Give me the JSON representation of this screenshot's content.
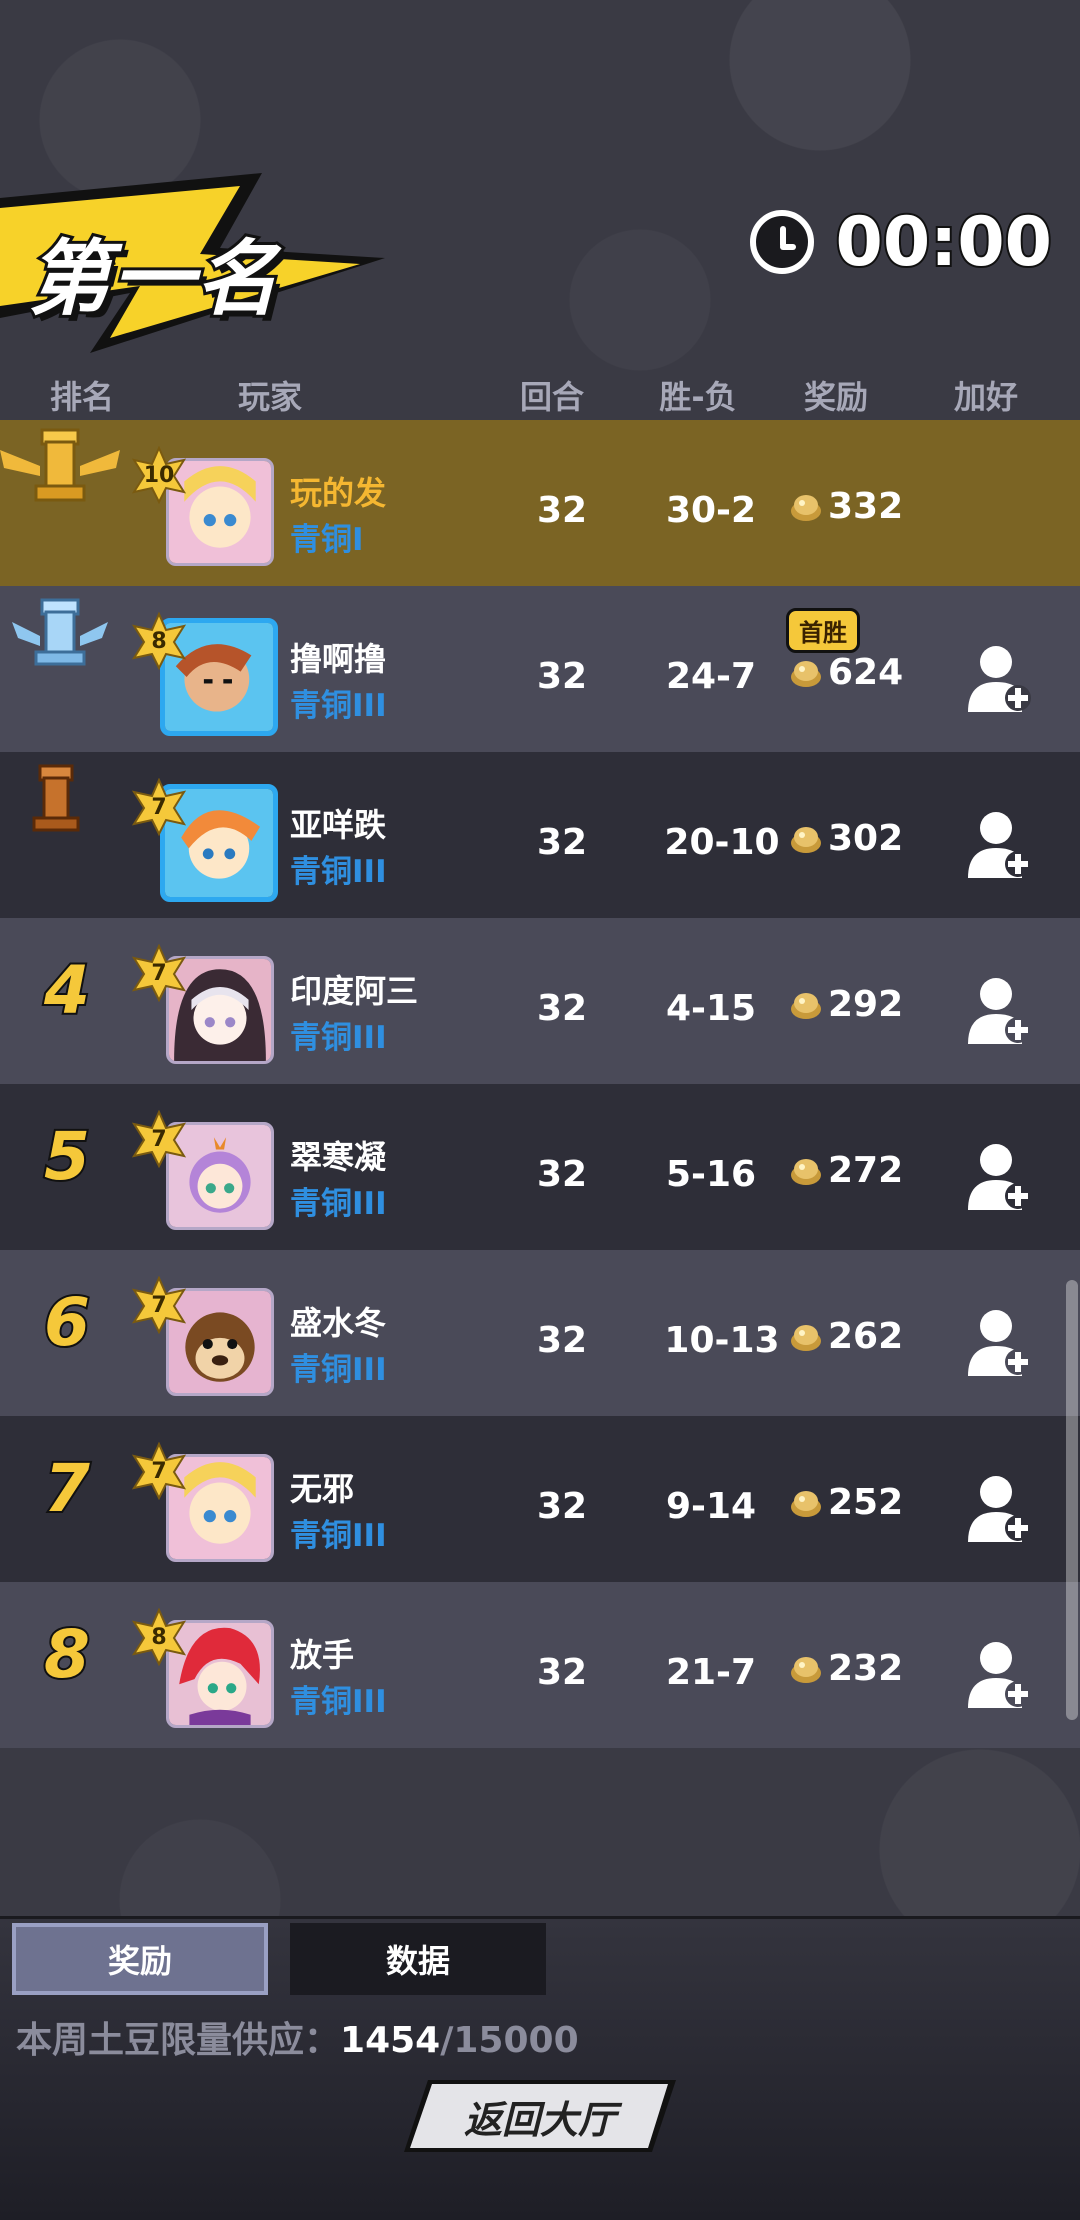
{
  "header": {
    "rank_title": "第一名",
    "timer": "00:00"
  },
  "columns": {
    "rank": "排名",
    "player": "玩家",
    "rounds": "回合",
    "win_loss": "胜-负",
    "reward": "奖励",
    "add_friend": "加好友"
  },
  "players": [
    {
      "rank": "1",
      "level": "10",
      "name": "玩的发",
      "tier": "青铜I",
      "rounds": "32",
      "record": "30-2",
      "reward": "332"
    },
    {
      "rank": "2",
      "level": "8",
      "name": "撸啊撸",
      "tier": "青铜III",
      "rounds": "32",
      "record": "24-7",
      "reward": "624",
      "badge": "首胜"
    },
    {
      "rank": "3",
      "level": "7",
      "name": "亚咩跌",
      "tier": "青铜III",
      "rounds": "32",
      "record": "20-10",
      "reward": "302"
    },
    {
      "rank": "4",
      "level": "7",
      "name": "印度阿三",
      "tier": "青铜III",
      "rounds": "32",
      "record": "4-15",
      "reward": "292"
    },
    {
      "rank": "5",
      "level": "7",
      "name": "翠寒凝",
      "tier": "青铜III",
      "rounds": "32",
      "record": "5-16",
      "reward": "272"
    },
    {
      "rank": "6",
      "level": "7",
      "name": "盛水冬",
      "tier": "青铜III",
      "rounds": "32",
      "record": "10-13",
      "reward": "262"
    },
    {
      "rank": "7",
      "level": "7",
      "name": "无邪",
      "tier": "青铜III",
      "rounds": "32",
      "record": "9-14",
      "reward": "252"
    },
    {
      "rank": "8",
      "level": "8",
      "name": "放手",
      "tier": "青铜III",
      "rounds": "32",
      "record": "21-7",
      "reward": "232"
    }
  ],
  "bottom": {
    "tab_reward": "奖励",
    "tab_data": "数据",
    "supply_label": "本周土豆限量供应：",
    "supply_current": "1454",
    "supply_max": "/15000",
    "back_button": "返回大厅"
  },
  "colors": {
    "highlight_row": "#7b6424",
    "tier_blue": "#2f8fe0",
    "rank_gold": "#f5c83a"
  },
  "icons": [
    "clock-icon",
    "gold-trophy-icon",
    "silver-trophy-icon",
    "bronze-trophy-icon",
    "coin-icon",
    "add-friend-icon",
    "level-star-icon"
  ]
}
